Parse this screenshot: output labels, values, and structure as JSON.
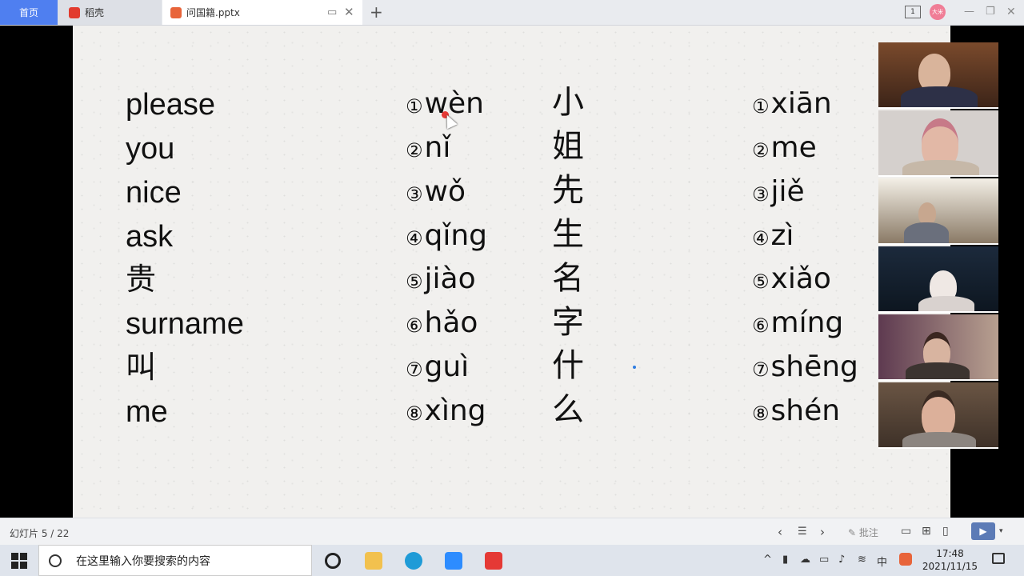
{
  "tabs": {
    "home": "首页",
    "daoke": "稻壳",
    "file": "问国籍.pptx"
  },
  "window": {
    "page_indicator": "1",
    "avatar_text": "大米"
  },
  "slide": {
    "english": [
      "please",
      "you",
      "nice",
      "ask",
      "贵",
      "surname",
      "叫",
      "me"
    ],
    "pinyin1": [
      {
        "num": "①",
        "text": "wèn"
      },
      {
        "num": "②",
        "text": "nǐ"
      },
      {
        "num": "③",
        "text": "wǒ"
      },
      {
        "num": "④",
        "text": "qǐng"
      },
      {
        "num": "⑤",
        "text": "jiào"
      },
      {
        "num": "⑥",
        "text": "hǎo"
      },
      {
        "num": "⑦",
        "text": "guì"
      },
      {
        "num": "⑧",
        "text": "xìng"
      }
    ],
    "hanzi": [
      "小",
      "姐",
      "先",
      "生",
      "名",
      "字",
      "什",
      "么"
    ],
    "pinyin2": [
      {
        "num": "①",
        "text": "xiān"
      },
      {
        "num": "②",
        "text": "me"
      },
      {
        "num": "③",
        "text": "jiě"
      },
      {
        "num": "④",
        "text": "zì"
      },
      {
        "num": "⑤",
        "text": "xiǎo"
      },
      {
        "num": "⑥",
        "text": "míng"
      },
      {
        "num": "⑦",
        "text": "shēng"
      },
      {
        "num": "⑧",
        "text": "shén"
      }
    ]
  },
  "statusbar": {
    "slide_count": "幻灯片 5 / 22",
    "annotate": "批注"
  },
  "taskbar": {
    "search_placeholder": "在这里输入你要搜索的内容",
    "time": "17:48",
    "date": "2021/11/15",
    "ime": "中"
  }
}
